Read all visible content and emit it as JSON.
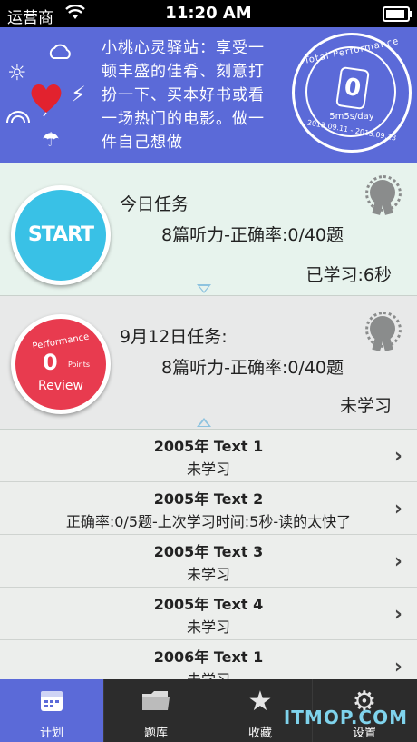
{
  "status_bar": {
    "carrier": "运营商",
    "time": "11:20 AM"
  },
  "banner": {
    "quote": "小桃心灵驿站：享受一顿丰盛的佳肴、刻意打扮一下、买本好书或看一场热门的电影。做一件自己想做",
    "seal": {
      "label": "Total Performance",
      "value": "0",
      "rate": "5m5s/day",
      "dates": "2013.09.11 - 2013.09.13"
    }
  },
  "today": {
    "button_label": "START",
    "title": "今日任务",
    "detail": "8篇听力-正确率:0/40题",
    "status": "已学习:6秒"
  },
  "review": {
    "button": {
      "top": "Performance",
      "value": "0",
      "unit": "Points",
      "bottom": "Review"
    },
    "title": "9月12日任务:",
    "detail": "8篇听力-正确率:0/40题",
    "status": "未学习"
  },
  "list": [
    {
      "title": "2005年 Text 1",
      "subtitle": "未学习"
    },
    {
      "title": "2005年 Text 2",
      "subtitle": "正确率:0/5题-上次学习时间:5秒-读的太快了"
    },
    {
      "title": "2005年 Text 3",
      "subtitle": "未学习"
    },
    {
      "title": "2005年 Text 4",
      "subtitle": "未学习"
    },
    {
      "title": "2006年 Text 1",
      "subtitle": "未学习"
    }
  ],
  "tabs": [
    {
      "label": "计划",
      "icon": "calendar-icon"
    },
    {
      "label": "题库",
      "icon": "folder-icon"
    },
    {
      "label": "收藏",
      "icon": "star-icon"
    },
    {
      "label": "设置",
      "icon": "gear-icon"
    }
  ],
  "watermark": "ITMOP.COM",
  "colors": {
    "banner": "#5b6ad8",
    "start": "#39c1e6",
    "review": "#e83b4f",
    "tabbar": "#2c2c2c"
  }
}
